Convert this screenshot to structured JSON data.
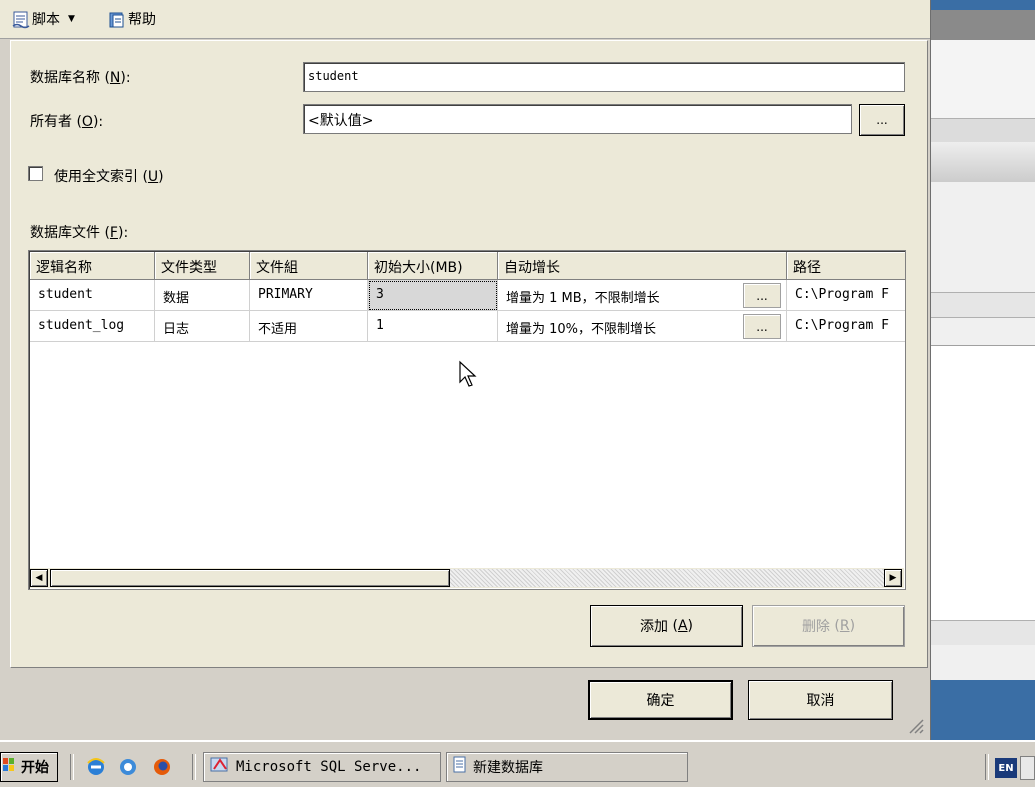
{
  "toolbar": {
    "script_label": "脚本",
    "help_label": "帮助"
  },
  "form": {
    "db_name_label": "数据库名称",
    "db_name_key": "N",
    "db_name_value": "student",
    "owner_label": "所有者",
    "owner_key": "O",
    "owner_value": "<默认值>",
    "owner_browse_label": "...",
    "fulltext_label": "使用全文索引",
    "fulltext_key": "U",
    "fulltext_checked": false,
    "files_label": "数据库文件",
    "files_key": "F"
  },
  "grid": {
    "columns": [
      "逻辑名称",
      "文件类型",
      "文件組",
      "初始大小(MB)",
      "自动增长",
      "路径"
    ],
    "rows": [
      {
        "name": "student",
        "type": "数据",
        "group": "PRIMARY",
        "size": "3",
        "growth": "增量为 1 MB，不限制增长",
        "path": "C:\\Program F"
      },
      {
        "name": "student_log",
        "type": "日志",
        "group": "不适用",
        "size": "1",
        "growth": "增量为 10%，不限制增长",
        "path": "C:\\Program F"
      }
    ],
    "ellipsis": "..."
  },
  "buttons": {
    "add": "添加",
    "add_key": "A",
    "remove": "删除",
    "remove_key": "R",
    "ok": "确定",
    "cancel": "取消"
  },
  "taskbar": {
    "start": "开始",
    "tasks": [
      "Microsoft SQL Serve...",
      "新建数据库"
    ],
    "tray": "EN"
  },
  "icons": {
    "script": "script-icon",
    "help": "help-icon",
    "start": "windows-flag-icon",
    "quick": [
      "ie-icon",
      "show-desktop-icon",
      "firefox-icon"
    ]
  }
}
